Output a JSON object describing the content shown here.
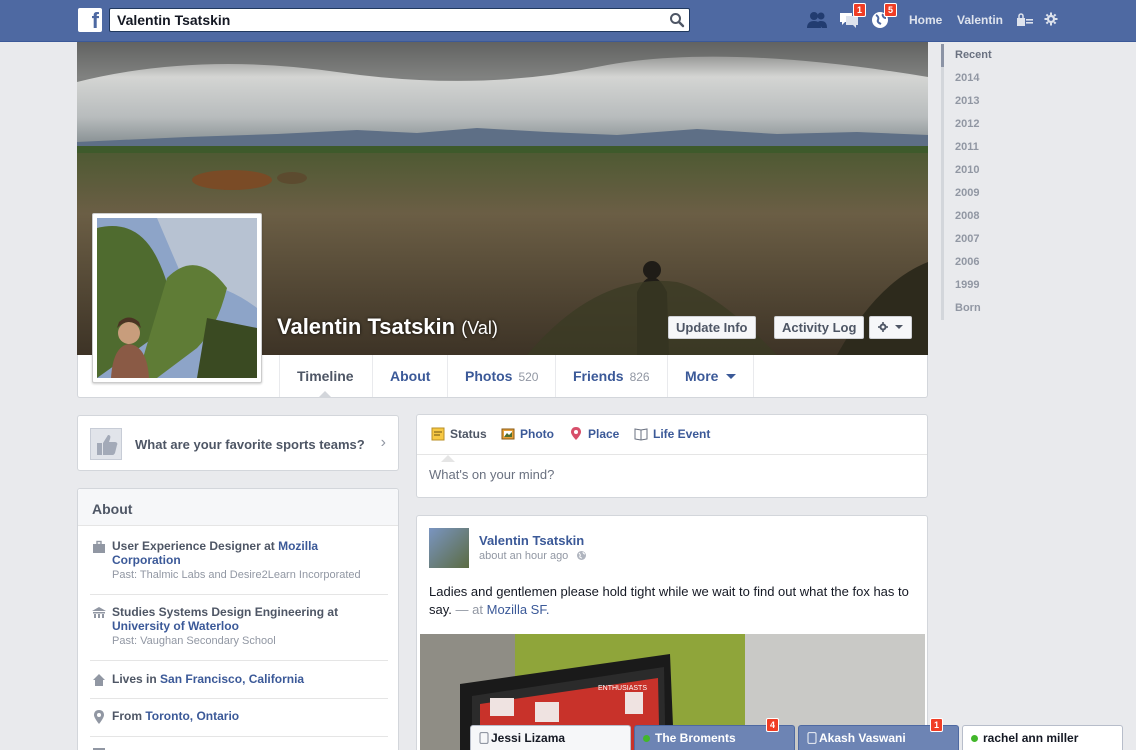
{
  "topbar": {
    "logo": "f",
    "search_value": "Valentin Tsatskin",
    "friend_requests_count": "",
    "messages_count": "1",
    "notifications_count": "5",
    "home_label": "Home",
    "user_label": "Valentin"
  },
  "profile": {
    "name": "Valentin Tsatskin",
    "nickname": "(Val)",
    "update_info_label": "Update Info",
    "activity_log_label": "Activity Log"
  },
  "nav": {
    "timeline": "Timeline",
    "about": "About",
    "photos": "Photos",
    "photos_count": "520",
    "friends": "Friends",
    "friends_count": "826",
    "more": "More"
  },
  "years": [
    "Recent",
    "2014",
    "2013",
    "2012",
    "2011",
    "2010",
    "2009",
    "2008",
    "2007",
    "2006",
    "1999",
    "Born"
  ],
  "prompt": {
    "text": "What are your favorite sports teams?"
  },
  "about": {
    "title": "About",
    "work_prefix": "User Experience Designer at",
    "work_link": "Mozilla Corporation",
    "work_past": "Past: Thalmic Labs and Desire2Learn Incorporated",
    "edu_prefix": "Studies Systems Design Engineering at",
    "edu_link": "University of Waterloo",
    "edu_past": "Past: Vaughan Secondary School",
    "lives_prefix": "Lives in",
    "lives_link": "San Francisco, California",
    "from_prefix": "From",
    "from_link": "Toronto, Ontario"
  },
  "composer": {
    "status": "Status",
    "photo": "Photo",
    "place": "Place",
    "life_event": "Life Event",
    "placeholder": "What's on your mind?"
  },
  "post": {
    "author": "Valentin Tsatskin",
    "time": "about an hour ago",
    "text": "Ladies and gentlemen please hold tight while we wait to find out what the fox has to say.",
    "at_label": "— at",
    "place": "Mozilla SF."
  },
  "chat": [
    {
      "name": "Jessi Lizama",
      "badge": ""
    },
    {
      "name": "The Broments",
      "badge": "4"
    },
    {
      "name": "Akash Vaswani",
      "badge": "1"
    },
    {
      "name": "rachel ann miller",
      "badge": ""
    }
  ],
  "colors": {
    "brand": "#4e69a2",
    "link": "#3b5998",
    "badge": "#f03d25"
  }
}
